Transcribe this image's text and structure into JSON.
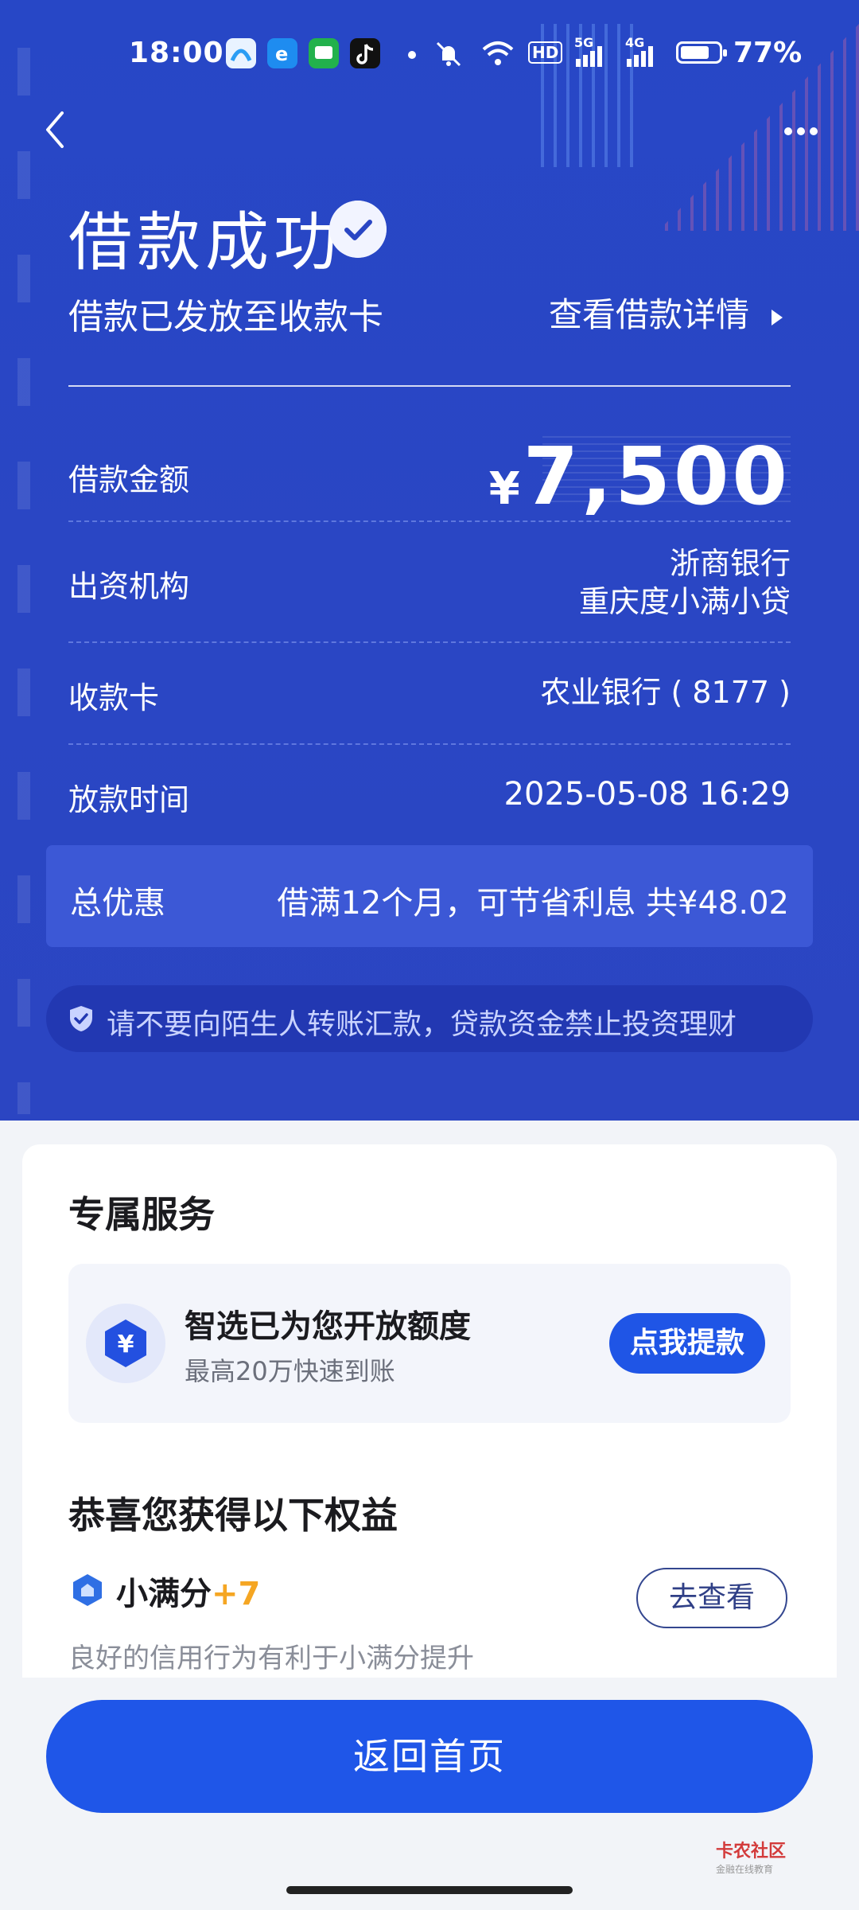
{
  "status_bar": {
    "time": "18:00",
    "battery_text": "77%",
    "battery_level": 0.77,
    "network_labels": [
      "5G",
      "4G"
    ],
    "wifi_badge": "HD",
    "app_icons": [
      "maps-app-icon",
      "browser-app-icon",
      "messages-app-icon",
      "tiktok-app-icon"
    ]
  },
  "header": {
    "title": "借款成功",
    "subtitle": "借款已发放至收款卡",
    "detail_link": "查看借款详情"
  },
  "loan": {
    "amount_label": "借款金额",
    "currency": "¥",
    "amount": "7,500",
    "lender_label": "出资机构",
    "lender_line1": "浙商银行",
    "lender_line2": "重庆度小满小贷",
    "card_label": "收款卡",
    "card_value": "农业银行 ( 8177 )",
    "time_label": "放款时间",
    "time_value": "2025-05-08 16:29"
  },
  "discount": {
    "label": "总优惠",
    "value": "借满12个月，可节省利息 共¥48.02"
  },
  "warning": {
    "text": "请不要向陌生人转账汇款，贷款资金禁止投资理财"
  },
  "services": {
    "title": "专属服务",
    "item_title": "智选已为您开放额度",
    "item_subtitle": "最高20万快速到账",
    "item_button": "点我提款"
  },
  "benefits": {
    "title": "恭喜您获得以下权益",
    "name": "小满分",
    "points": "+7",
    "description": "良好的信用行为有利于小满分提升",
    "button": "去查看"
  },
  "footer": {
    "home_button": "返回首页",
    "watermark": "卡农社区",
    "watermark_sub": "金融在线教育"
  },
  "colors": {
    "hero_blue": "#2a46c4",
    "primary_button": "#1f56e8",
    "points_orange": "#f5a623"
  }
}
